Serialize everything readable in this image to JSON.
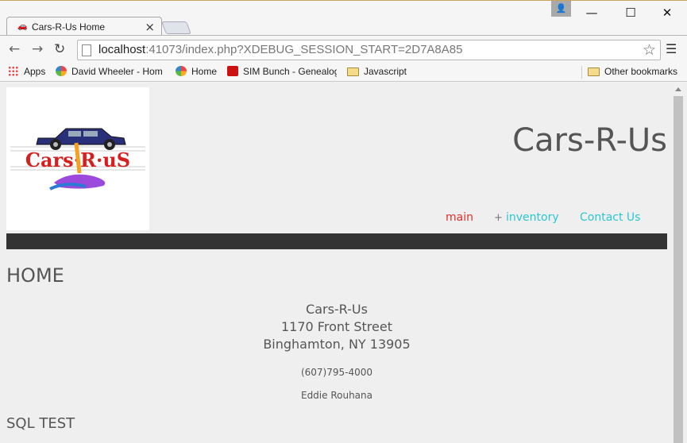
{
  "browser": {
    "tab_title": "Cars-R-Us Home",
    "tab_close": "×",
    "url_host": "localhost",
    "url_rest": ":41073/index.php?XDEBUG_SESSION_START=2D7A8A85",
    "bookmarks": [
      "Apps",
      "David Wheeler - Hom",
      "Home",
      "SIM Bunch - Genealog",
      "Javascript"
    ],
    "other_bookmarks": "Other bookmarks"
  },
  "site": {
    "title": "Cars-R-Us",
    "logo_text": "Cars·R·uS",
    "nav": {
      "main": "main",
      "plus": "+",
      "inventory": "inventory",
      "contact": "Contact Us"
    }
  },
  "content": {
    "heading": "HOME",
    "address_name": "Cars-R-Us",
    "address_street": "1170 Front Street",
    "address_city": "Binghamton, NY 13905",
    "phone": "(607)795-4000",
    "owner": "Eddie Rouhana",
    "sql_heading": "SQL TEST"
  },
  "colors": {
    "nav_active": "#e0302a",
    "nav_link": "#2bc7cf",
    "dark_bar": "#333333"
  }
}
